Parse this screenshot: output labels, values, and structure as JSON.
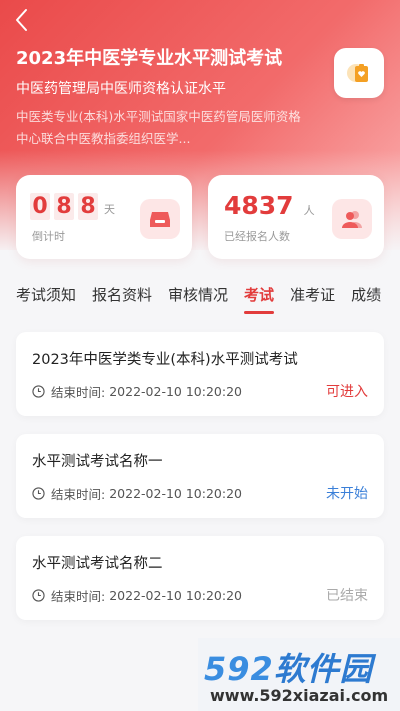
{
  "header": {
    "title": "2023年中医学专业水平测试考试",
    "subtitle": "中医药管理局中医师资格认证水平",
    "description": "中医类专业(本科)水平测试国家中医药管局医师资格中心联合中医教指委组织医学..."
  },
  "stats": {
    "countdown": {
      "digits": [
        "0",
        "8",
        "8"
      ],
      "unit": "天",
      "label": "倒计时"
    },
    "signup": {
      "value": "4837",
      "unit": "人",
      "label": "已经报名人数"
    }
  },
  "tabs": [
    {
      "label": "考试须知",
      "active": false
    },
    {
      "label": "报名资料",
      "active": false
    },
    {
      "label": "审核情况",
      "active": false
    },
    {
      "label": "考试",
      "active": true
    },
    {
      "label": "准考证",
      "active": false
    },
    {
      "label": "成绩",
      "active": false
    }
  ],
  "exams": [
    {
      "name": "2023年中医学类专业(本科)水平测试考试",
      "end_label": "结束时间:",
      "end_time": "2022-02-10 10:20:20",
      "status": "可进入",
      "status_color": "#e23c3c"
    },
    {
      "name": "水平测试考试名称一",
      "end_label": "结束时间:",
      "end_time": "2022-02-10 10:20:20",
      "status": "未开始",
      "status_color": "#3a7fd8"
    },
    {
      "name": "水平测试考试名称二",
      "end_label": "结束时间:",
      "end_time": "2022-02-10 10:20:20",
      "status": "已结束",
      "status_color": "#aaaaaa"
    }
  ],
  "watermark": {
    "logo_num": "592",
    "logo_text": "软件园",
    "url": "www.592xiazai.com"
  },
  "colors": {
    "accent": "#e23c3c"
  }
}
